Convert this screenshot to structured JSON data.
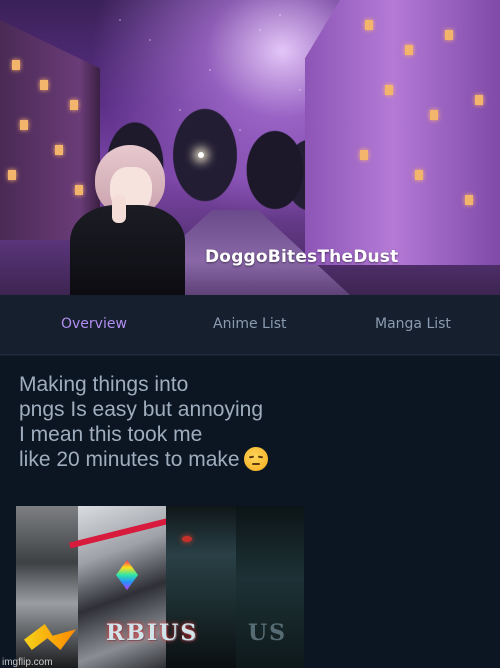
{
  "profile": {
    "username": "DoggoBitesTheDust"
  },
  "nav": {
    "tabs": [
      {
        "label": "Overview",
        "active": true
      },
      {
        "label": "Anime List",
        "active": false
      },
      {
        "label": "Manga List",
        "active": false
      }
    ],
    "active_color": "#b28ef0",
    "inactive_color": "#8b9bb0"
  },
  "post": {
    "lines": [
      "Making things into",
      "pngs Is easy but annoying",
      "I mean this took me",
      "like 20 minutes to make"
    ],
    "emoji": "pensive-face-emoji",
    "image": {
      "title_text": "RBIUS",
      "ghost_text": "US"
    }
  },
  "watermark": "imgflip.com",
  "colors": {
    "page_background": "#0b1622",
    "nav_background": "#151f2e",
    "text": "#9fadbd"
  }
}
